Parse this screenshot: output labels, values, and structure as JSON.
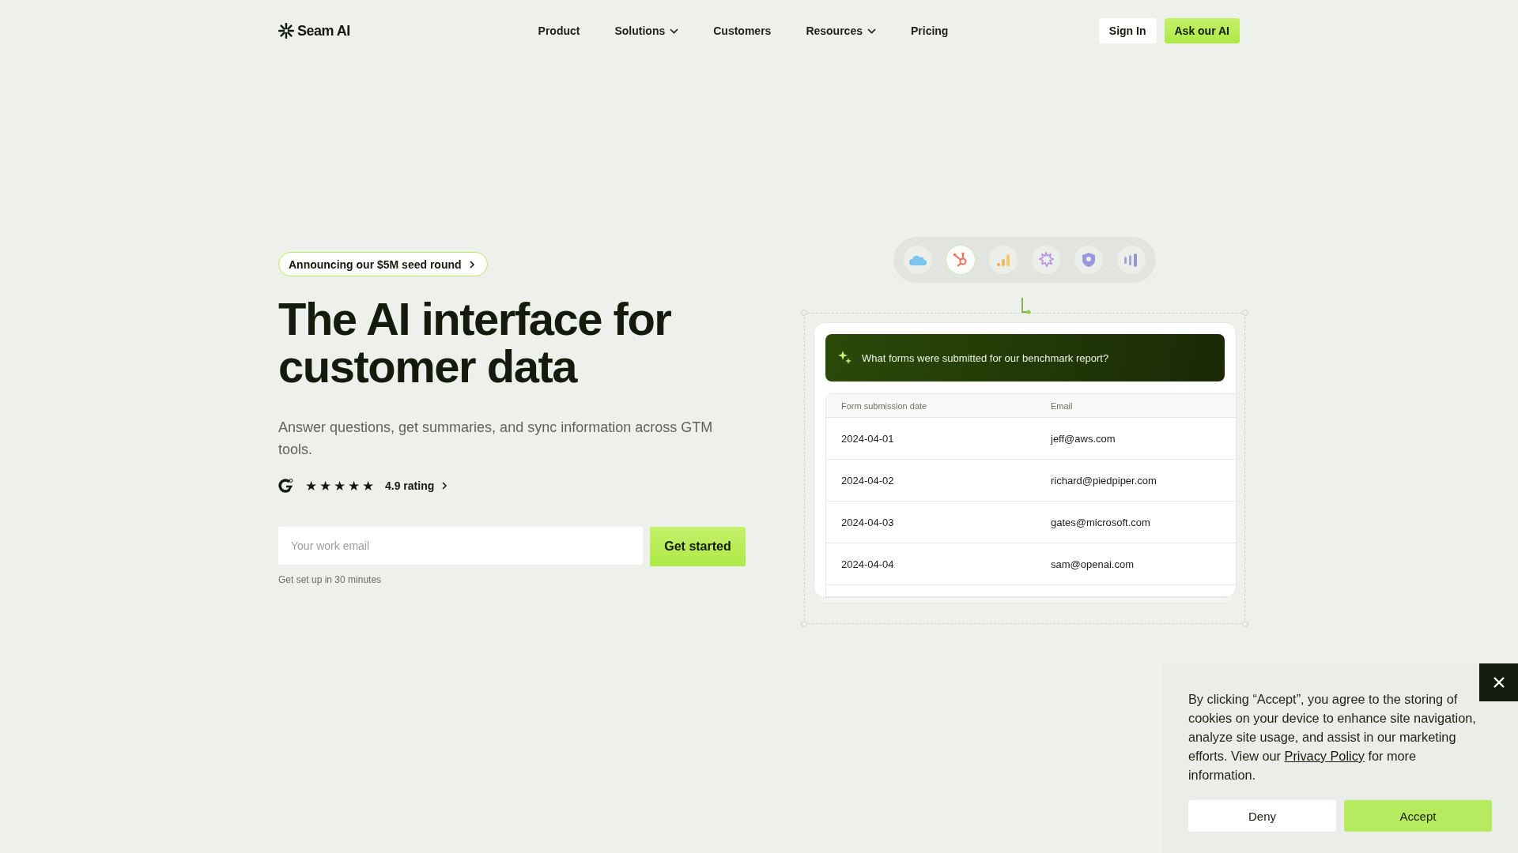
{
  "header": {
    "logo": "Seam AI",
    "nav": [
      {
        "label": "Product",
        "dropdown": false
      },
      {
        "label": "Solutions",
        "dropdown": true
      },
      {
        "label": "Customers",
        "dropdown": false
      },
      {
        "label": "Resources",
        "dropdown": true
      },
      {
        "label": "Pricing",
        "dropdown": false
      }
    ],
    "sign_in": "Sign In",
    "cta": "Ask our AI"
  },
  "hero": {
    "badge": "Announcing our $5M seed round",
    "title": "The AI interface for customer data",
    "subtitle": "Answer questions, get summaries, and sync information across GTM tools.",
    "rating": {
      "stars": 5,
      "label": "4.9 rating"
    },
    "email": {
      "placeholder": "Your work email"
    },
    "submit": "Get started",
    "note": "Get set up in 30 minutes"
  },
  "integrations": [
    {
      "kind": "cloud",
      "selected": false
    },
    {
      "kind": "hub",
      "selected": true
    },
    {
      "kind": "bars",
      "selected": false
    },
    {
      "kind": "burst",
      "selected": false
    },
    {
      "kind": "shield",
      "selected": false
    },
    {
      "kind": "columns",
      "selected": false
    }
  ],
  "demo": {
    "question": "What forms were submitted for our benchmark report?",
    "table": {
      "columns": [
        "Form submission date",
        "Email"
      ],
      "rows": [
        [
          "2024-04-01",
          "jeff@aws.com"
        ],
        [
          "2024-04-02",
          "richard@piedpiper.com"
        ],
        [
          "2024-04-03",
          "gates@microsoft.com"
        ],
        [
          "2024-04-04",
          "sam@openai.com"
        ]
      ]
    }
  },
  "cookie_banner": {
    "text_before": "By clicking “Accept”, you agree to the storing of cookies on your device to enhance site navigation, analyze site usage, and assist in our marketing efforts. View our ",
    "link": "Privacy Policy",
    "text_after": " for more information.",
    "buttons": [
      "Deny",
      "Accept"
    ]
  }
}
